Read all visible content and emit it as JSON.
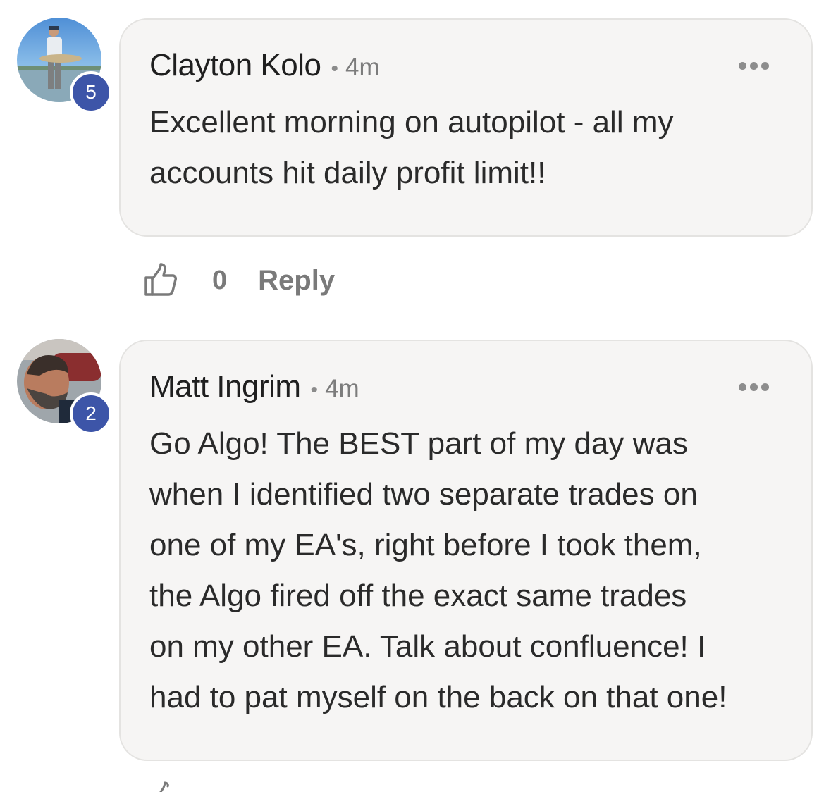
{
  "comments": [
    {
      "author": "Clayton Kolo",
      "separator": "•",
      "time": "4m",
      "level": "5",
      "text": "Excellent morning on autopilot - all my\naccounts hit daily profit limit!!",
      "likes": "0",
      "reply_label": "Reply"
    },
    {
      "author": "Matt Ingrim",
      "separator": "•",
      "time": "4m",
      "level": "2",
      "text": "Go Algo! The BEST part of my day was\nwhen I identified two separate trades on\none of my EA's, right before I took them,\nthe Algo fired off the exact same trades\non my other EA. Talk about confluence! I\nhad to pat myself on the back on that one!"
    }
  ],
  "colors": {
    "badge": "#3d55a8",
    "bubble_bg": "#f6f5f4",
    "bubble_border": "#e4e3e1",
    "muted_text": "#7a7a7a"
  },
  "icons": {
    "like": "thumbs-up-icon",
    "more": "more-options-icon"
  }
}
